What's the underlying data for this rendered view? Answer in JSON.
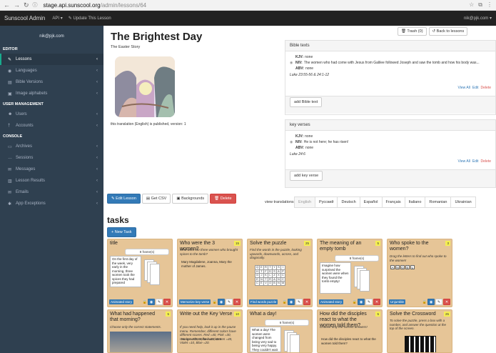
{
  "browser": {
    "url_host": "stage.api.sunscool.org",
    "url_path": "/admin/lessons/64"
  },
  "navbar": {
    "brand": "Sunscool Admin",
    "api_label": "API ▾",
    "update_label": "Update This Lesson",
    "user": "nik@pjk.com ▾"
  },
  "sidebar": {
    "user": "nik@pjk.com",
    "sections": [
      {
        "title": "EDITOR",
        "items": [
          {
            "icon": "pencil-icon",
            "glyph": "✎",
            "label": "Lessons",
            "active": true
          },
          {
            "icon": "globe-icon",
            "glyph": "◉",
            "label": "Languages"
          },
          {
            "icon": "book-icon",
            "glyph": "▤",
            "label": "Bible Versions"
          },
          {
            "icon": "image-icon",
            "glyph": "▣",
            "label": "Image alphabets"
          }
        ]
      },
      {
        "title": "USER MANAGEMENT",
        "items": [
          {
            "icon": "users-icon",
            "glyph": "☻",
            "label": "Users"
          },
          {
            "icon": "accounts-icon",
            "glyph": "†",
            "label": "Accounts"
          }
        ]
      },
      {
        "title": "CONSOLE",
        "items": [
          {
            "icon": "archive-icon",
            "glyph": "▭",
            "label": "Archives"
          },
          {
            "icon": "sessions-icon",
            "glyph": "…",
            "label": "Sessions"
          },
          {
            "icon": "messages-icon",
            "glyph": "✉",
            "label": "Messages"
          },
          {
            "icon": "results-icon",
            "glyph": "▥",
            "label": "Lesson Results"
          },
          {
            "icon": "email-icon",
            "glyph": "✉",
            "label": "Emails"
          },
          {
            "icon": "exceptions-icon",
            "glyph": "✱",
            "label": "App Exceptions"
          }
        ]
      }
    ]
  },
  "lesson": {
    "title": "The Brightest Day",
    "subtitle": "The Easter Story",
    "trash_label": "Trash (0)",
    "back_label": "Back to lessons",
    "publish_note": "this translation (English) is published, version: 1"
  },
  "bible_texts": {
    "header": "Bible texts",
    "rows": [
      {
        "ver": "KJV:",
        "text": "none"
      },
      {
        "ver": "NIV:",
        "text": "The women who had come with Jesus from Galilee followed Joseph and saw the tomb and how his body was..."
      },
      {
        "ver": "ABV:",
        "text": "none"
      }
    ],
    "reference": "Luke 23:55-56 & 24:1-12",
    "view_all": "View All",
    "edit": "Edit",
    "delete": "Delete",
    "add_button": "add Bible text"
  },
  "key_verses": {
    "header": "key verses",
    "rows": [
      {
        "ver": "KJV:",
        "text": "none"
      },
      {
        "ver": "NIV:",
        "text": "He is not here; he has risen!"
      },
      {
        "ver": "ABV:",
        "text": "none"
      }
    ],
    "reference": "Luke 24:6",
    "view_all": "View All",
    "edit": "Edit",
    "delete": "Delete",
    "add_button": "add key verse"
  },
  "actions": {
    "edit": "Edit Lesson",
    "csv": "Get CSV",
    "backgrounds": "Backgrounds",
    "delete": "Delete"
  },
  "translations": {
    "label": "view translations:",
    "items": [
      "English",
      "Русский",
      "Deutsch",
      "Español",
      "Français",
      "Italiano",
      "Romanian",
      "Ukrainian"
    ]
  },
  "tasks": {
    "title": "tasks",
    "new_task": "New Task",
    "cards": [
      {
        "title": "title",
        "num": "",
        "desc": "",
        "frames": "8 frame(s)",
        "body": "On the first day of the week, very early in the morning, three women took the spices they had prepared",
        "tag": "Animated story"
      },
      {
        "title": "Who were the 3 women?",
        "num": "15",
        "desc": "Who were the three women who brought spices to the tomb?",
        "body": "Mary Magdalene, Joanna, Mary the mother of James.",
        "tag": "Memorize key verse"
      },
      {
        "title": "Solve the puzzle",
        "num": "25",
        "desc": "Find the words in the puzzle, looking upwards, downwards, across, and diagonally.",
        "grid": [
          [
            "Q",
            "E",
            "R",
            "T",
            "Y",
            "S",
            "I"
          ],
          [
            "H",
            "T",
            "F",
            "D",
            "S",
            "A",
            "P"
          ],
          [
            "G",
            "J",
            "K",
            "L",
            "Z",
            "X",
            "C"
          ],
          [
            "E",
            "N",
            "T",
            "R",
            "A",
            "N",
            "C"
          ],
          [
            "C",
            "E",
            "V",
            "O",
            "B",
            "N",
            "M"
          ]
        ],
        "tag": "Find words puzzle"
      },
      {
        "title": "The meaning of an empty tomb",
        "num": "5",
        "desc": "",
        "frames": "8 frame(s)",
        "body": "Imagine how surprised the women were when they found the tomb empty!",
        "tag": "Animated story"
      },
      {
        "title": "Who spoke to the women?",
        "num": "3",
        "desc": "Drag the letters to find out who spoke to the women!",
        "letters": [
          "A",
          "N",
          "G",
          "E",
          "L"
        ],
        "tag": "Unjumble"
      },
      {
        "title": "What had happened that morning?",
        "num": "5",
        "desc": "Choose only the correct statements.",
        "tag": ""
      },
      {
        "title": "Write out the Key Verse",
        "num": "10",
        "desc": "If you need help, look it up in the pause menu. Remember, different colors have different scores. Red =40, Pink =30, Orange =50, Yellow =20, Green =40, Violet =10, Blue =20.",
        "body": "He is not here; he has risen!",
        "tag": ""
      },
      {
        "title": "What a day!",
        "num": "",
        "desc": "",
        "frames": "6 frame(s)",
        "body": "What a day! The women were changed from being very sad to being very happy. They couldn't wait to let",
        "tag": ""
      },
      {
        "title": "How did the disciples react to what the women told them?",
        "num": "5",
        "desc": "Choose only the correct answers!",
        "body": "How did the disciples react to what the women told them?",
        "tag": ""
      },
      {
        "title": "Solve the Crossword",
        "num": "25",
        "desc": "To solve the puzzle, press a box with a number, and answer the question at the top of the screen.",
        "tag": ""
      }
    ]
  },
  "colors": {
    "sidebar": "#2f4050",
    "accent": "#19aa8d",
    "primary": "#337ab7",
    "danger": "#d9534f",
    "card": "#e6c597"
  }
}
